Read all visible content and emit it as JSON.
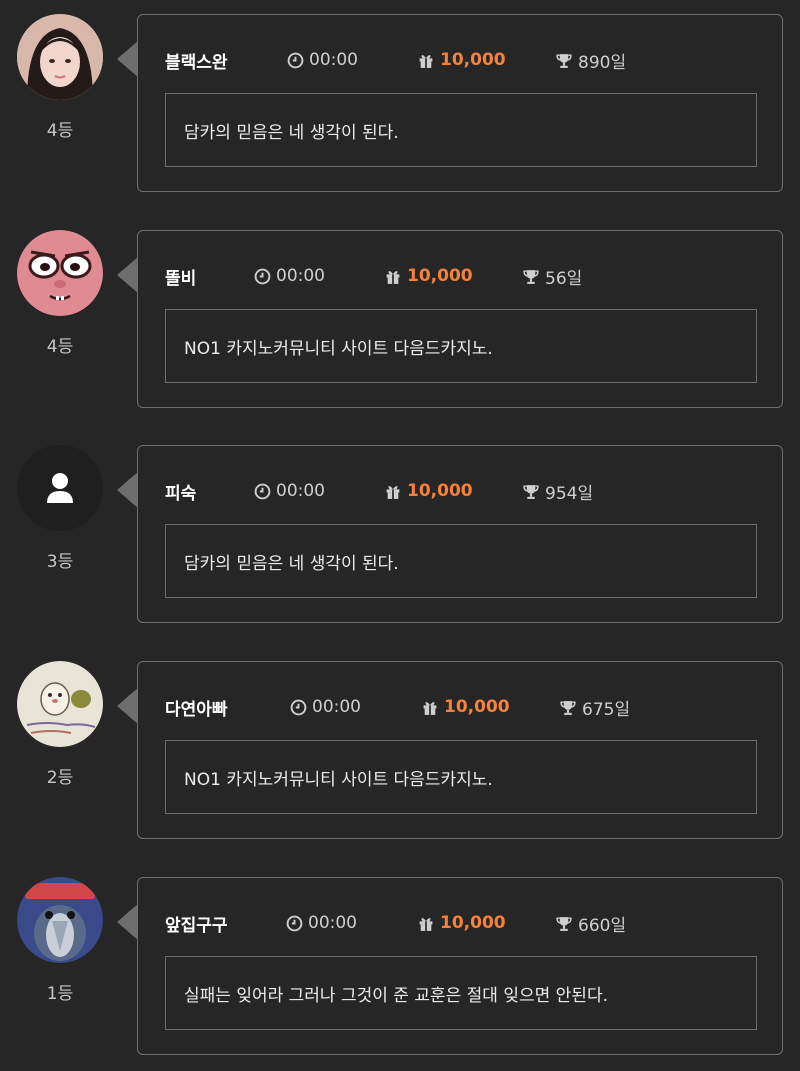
{
  "entries": [
    {
      "name": "블랙스완",
      "time": "00:00",
      "points": "10,000",
      "days": "890일",
      "rank": "4등",
      "message": "담카의 믿음은 네 생각이 된다.",
      "avatar": "avatar-photo-woman"
    },
    {
      "name": "똘비",
      "time": "00:00",
      "points": "10,000",
      "days": "56일",
      "rank": "4등",
      "message": "NO1 카지노커뮤니티 사이트 다음드카지노.",
      "avatar": "avatar-cartoon-pink-face"
    },
    {
      "name": "피숙",
      "time": "00:00",
      "points": "10,000",
      "days": "954일",
      "rank": "3등",
      "message": "담카의 믿음은 네 생각이 된다.",
      "avatar": "avatar-default-user"
    },
    {
      "name": "다연아빠",
      "time": "00:00",
      "points": "10,000",
      "days": "675일",
      "rank": "2등",
      "message": "NO1 카지노커뮤니티 사이트 다음드카지노.",
      "avatar": "avatar-hamster-drawing"
    },
    {
      "name": "앞집구구",
      "time": "00:00",
      "points": "10,000",
      "days": "660일",
      "rank": "1등",
      "message": "실패는 잊어라 그러나 그것이 준 교훈은 절대 잊으면 안된다.",
      "avatar": "avatar-crying-character"
    }
  ],
  "colors": {
    "background": "#262626",
    "border": "#6e6e6e",
    "points": "#f5823c",
    "name": "#ffffff"
  },
  "icons": {
    "time": "clock-icon",
    "points": "gift-icon",
    "days": "trophy-icon"
  }
}
